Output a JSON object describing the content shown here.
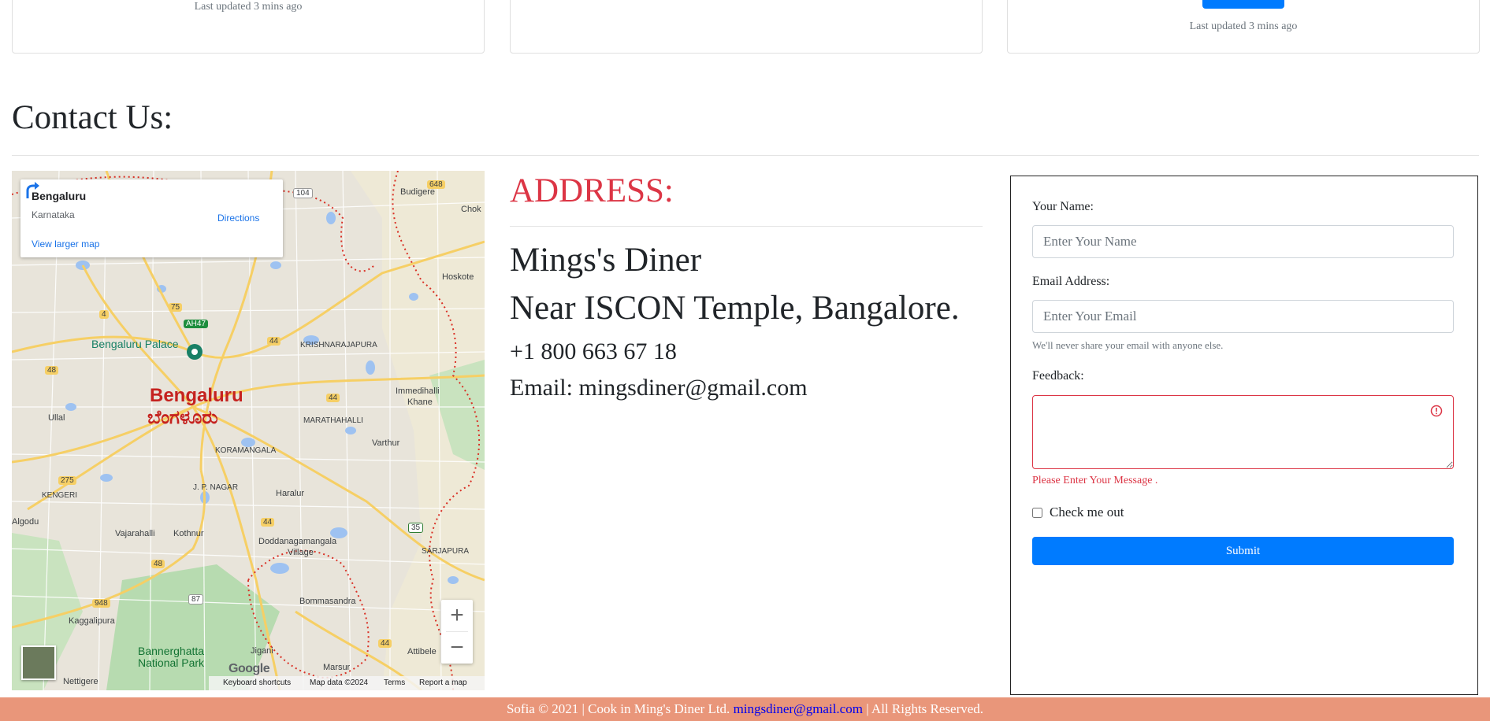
{
  "cards": {
    "updated_left": "Last updated 3 mins ago",
    "updated_right": "Last updated 3 mins ago"
  },
  "contact": {
    "title": "Contact Us:"
  },
  "map": {
    "place": "Bengaluru",
    "region": "Karnataka",
    "directions": "Directions",
    "view_larger": "View larger map",
    "city_label": "Bengaluru",
    "city_label_kn": "ಬೆಂಗಳೂರು",
    "palace_label": "Bengaluru Palace",
    "park_label_1": "Bannerghatta",
    "park_label_2": "National Park",
    "google": "Google",
    "labels": {
      "budigere": "Budigere",
      "hoskote": "Hoskote",
      "krishnarajapura": "KRISHNARAJAPURA",
      "immedihalli": "Immedihalli",
      "khane": "Khane",
      "marathahalli": "MARATHAHALLI",
      "varthur": "Varthur",
      "ullal": "Ullal",
      "koramangala": "KORAMANGALA",
      "jp_nagar": "J. P. NAGAR",
      "kengeri": "KENGERI",
      "haralur": "Haralur",
      "vajarahalli": "Vajarahalli",
      "kothnur": "Kothnur",
      "doddanagamangala": "Doddanagamangala",
      "village": "Village",
      "sarjapura": "SARJAPURA",
      "bommasandra": "Bommasandra",
      "kaggalipura": "Kaggalipura",
      "jigani": "Jigani",
      "marsur": "Marsur",
      "attibele": "Attibele",
      "nettigere": "Nettigere",
      "algodu": "Algodu",
      "chok": "Chok"
    },
    "road_badges": {
      "r104": "104",
      "r648": "648",
      "r4": "4",
      "r75": "75",
      "ah47": "AH47",
      "r44a": "44",
      "r44b": "44",
      "r48a": "48",
      "r275": "275",
      "r44c": "44",
      "r35": "35",
      "r48b": "48",
      "r948": "948",
      "r87": "87",
      "r44d": "44"
    },
    "footer": {
      "shortcuts": "Keyboard shortcuts",
      "mapdata": "Map data ©2024",
      "terms": "Terms",
      "report": "Report a map error"
    },
    "zoom_in": "+",
    "zoom_out": "−"
  },
  "address": {
    "title": "ADDRESS:",
    "name": "Mings's Diner",
    "street": "Near ISCON Temple, Bangalore.",
    "phone": "+1 800 663 67 18",
    "email": "Email: mingsdiner@gmail.com"
  },
  "form": {
    "name_label": "Your Name:",
    "name_placeholder": "Enter Your Name",
    "email_label": "Email Address:",
    "email_placeholder": "Enter Your Email",
    "email_help": "We'll never share your email with anyone else.",
    "feedback_label": "Feedback:",
    "feedback_error": "Please Enter Your Message .",
    "checkbox_label": "Check me out",
    "submit_label": "Submit"
  },
  "footer": {
    "prefix": "Sofia © 2021 | Cook in Ming's Diner Ltd. ",
    "email": "mingsdiner@gmail.com",
    "suffix": " | All Rights Reserved."
  },
  "colors": {
    "accent": "#007bff",
    "danger": "#dc3545",
    "footer_bg": "#e9967a"
  }
}
